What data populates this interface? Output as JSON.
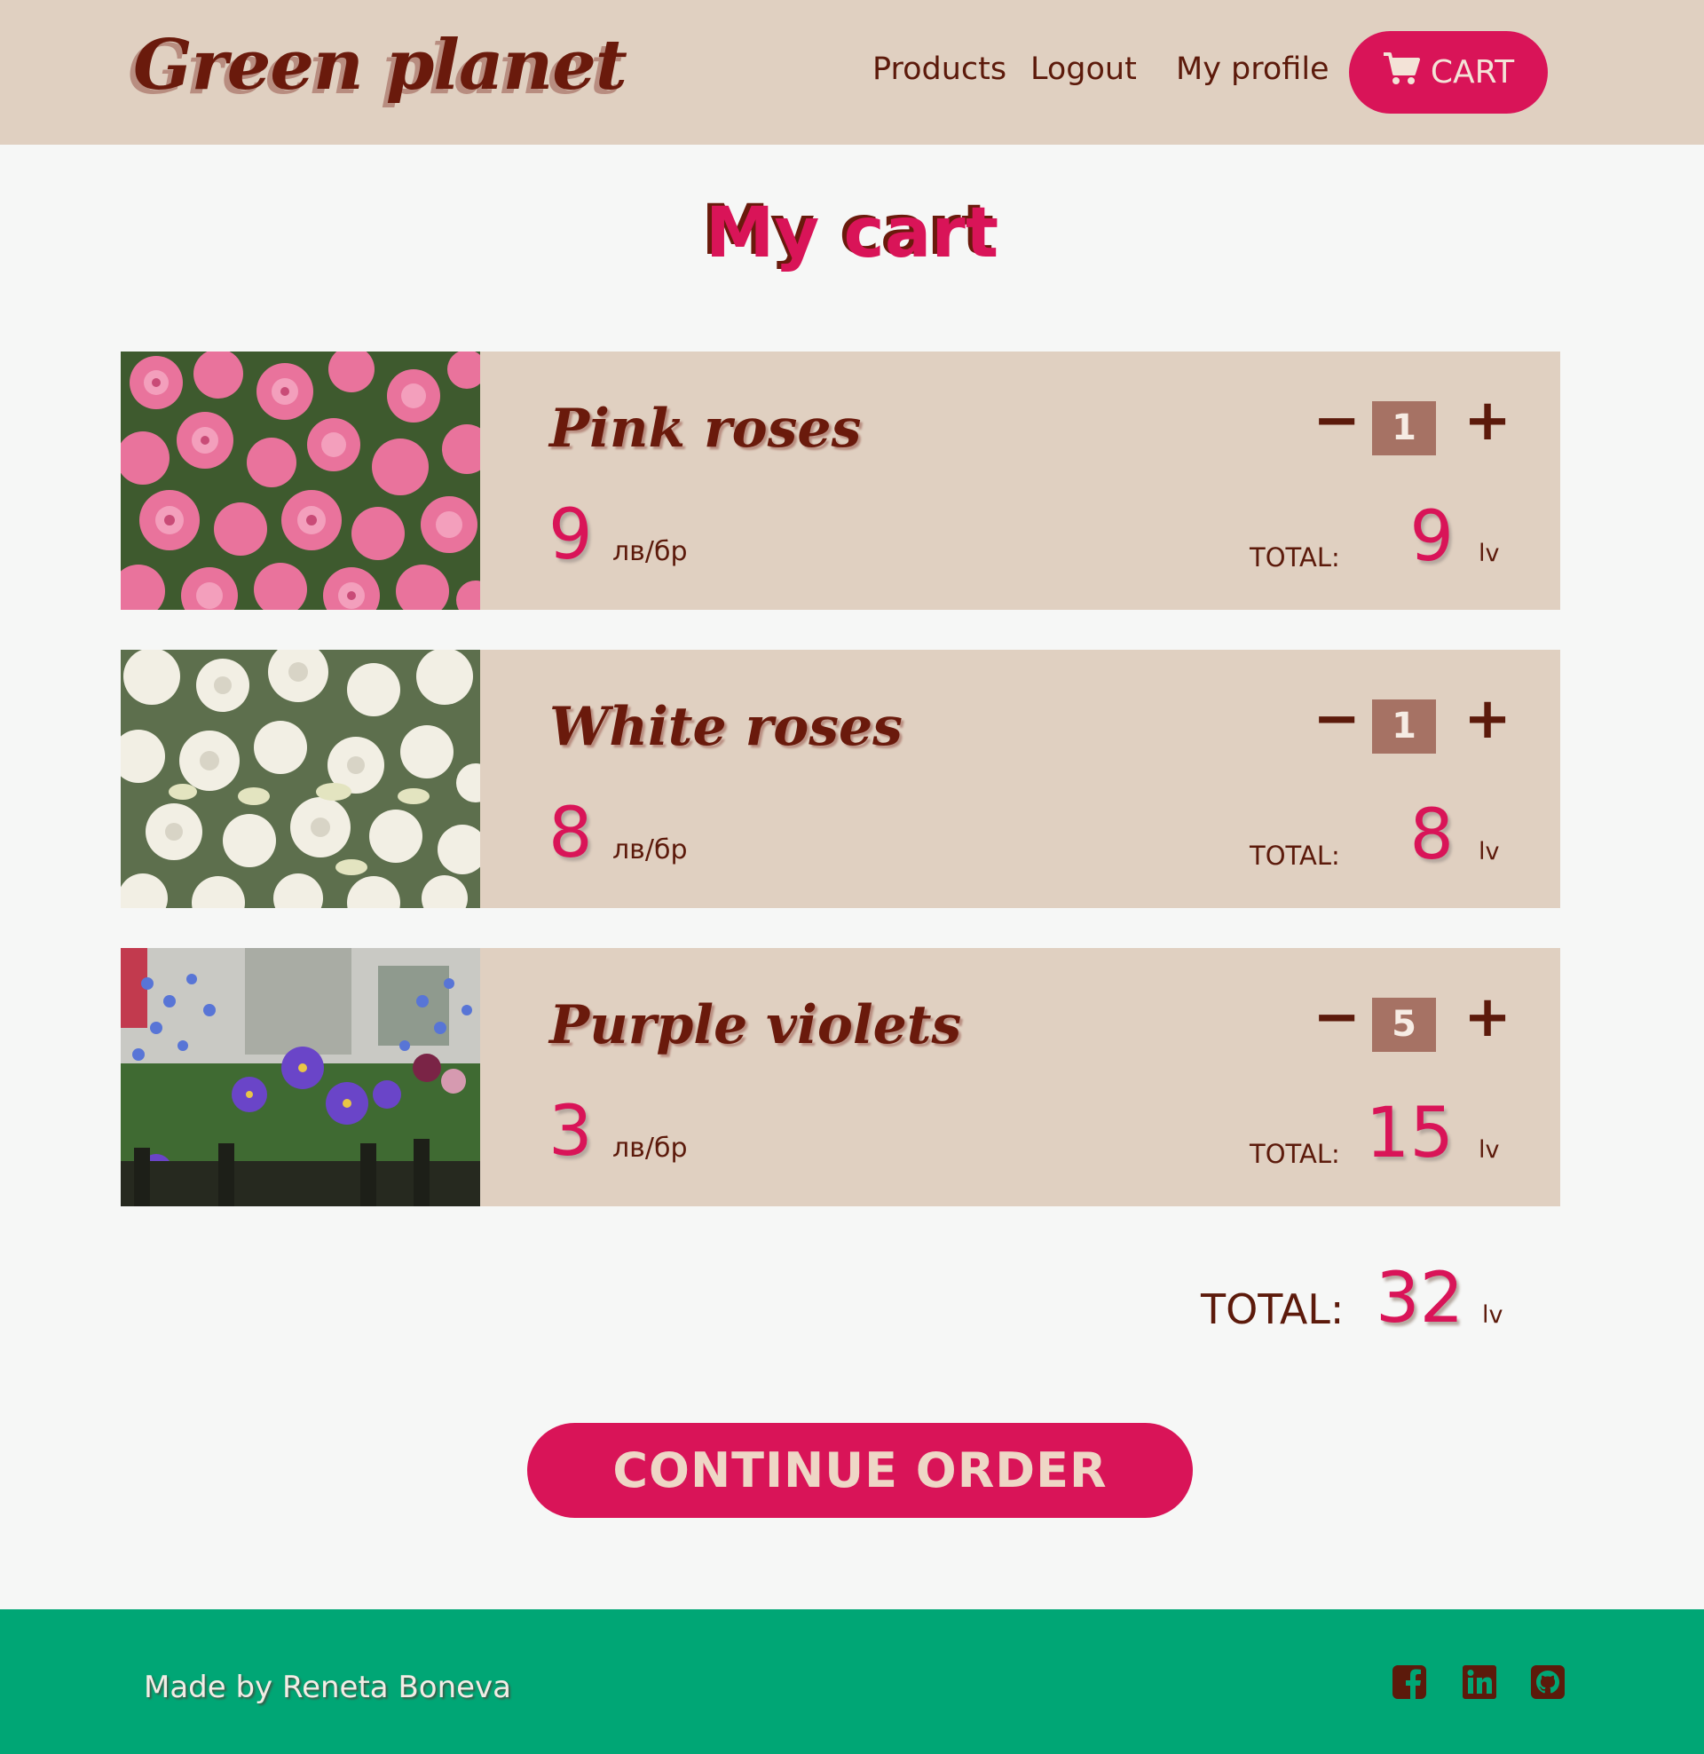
{
  "header": {
    "logo": "Green planet",
    "nav": {
      "products": "Products",
      "logout": "Logout",
      "profile": "My profile"
    },
    "cart_label": "CART",
    "cart_icon": "cart-icon"
  },
  "page": {
    "title": "My cart"
  },
  "items": [
    {
      "name": "Pink roses",
      "price": "9",
      "unit": "лв/бр",
      "quantity": "1",
      "total_label": "TOTAL:",
      "total": "9",
      "total_unit": "lv"
    },
    {
      "name": "White roses",
      "price": "8",
      "unit": "лв/бр",
      "quantity": "1",
      "total_label": "TOTAL:",
      "total": "8",
      "total_unit": "lv"
    },
    {
      "name": "Purple violets",
      "price": "3",
      "unit": "лв/бр",
      "quantity": "5",
      "total_label": "TOTAL:",
      "total": "15",
      "total_unit": "lv"
    }
  ],
  "qty_controls": {
    "minus": "−",
    "plus": "+"
  },
  "summary": {
    "label": "TOTAL:",
    "value": "32",
    "unit": "lv"
  },
  "continue_label": "CONTINUE ORDER",
  "footer": {
    "text": "Made by Reneta Boneva",
    "icons": [
      "facebook-icon",
      "linkedin-icon",
      "github-icon"
    ]
  },
  "colors": {
    "accent": "#d91458",
    "header_bg": "#e0d0c1",
    "footer_bg": "#00a675",
    "text_brown": "#5c1a0b"
  }
}
